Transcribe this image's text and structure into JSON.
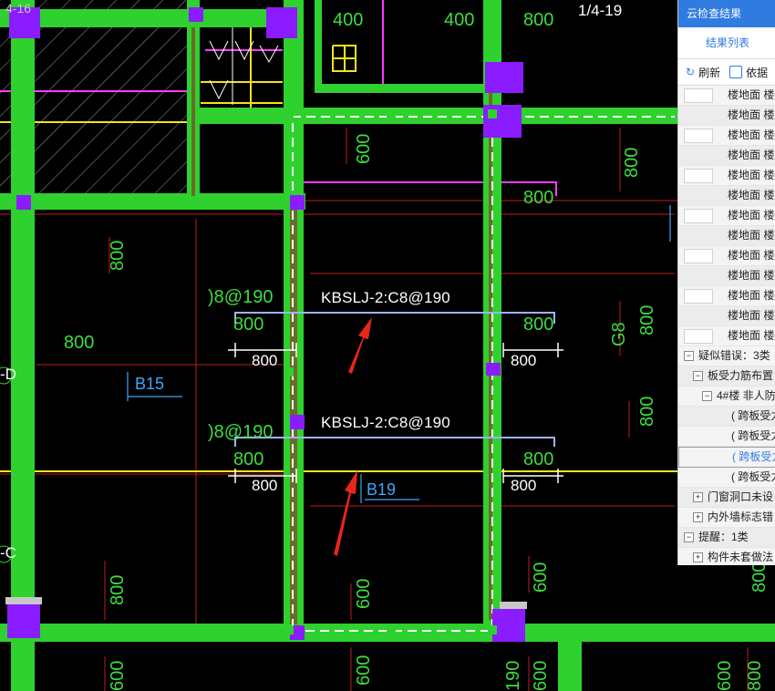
{
  "drawing": {
    "page_label": "1/4-19",
    "top_left_label": "4-16",
    "dims": {
      "d400a": "400",
      "d400b": "400",
      "d800_top": "800",
      "d600_a": "600",
      "d800_b": "800",
      "d800_right1": "800",
      "d800_left": "800",
      "d800_left2": "800",
      "d800_bar1l": "800",
      "d800_bar1r": "800",
      "d800_bar1bl": "800",
      "d800_bar1br": "800",
      "d800_bar2l": "800",
      "d800_bar2r": "800",
      "d800_bar2bl": "800",
      "d800_bar2br": "800",
      "d800_right2": "800",
      "d800_right3": "800",
      "d800_right4": "800",
      "d800_left3": "800",
      "d600_bot1": "600",
      "d600_bot2": "600",
      "d600_bot3": "600",
      "d600_bot4": "600",
      "d600_right5": "600",
      "d190": "190",
      "d600_bot5": "600",
      "d800_br": "800",
      "g8": "G8"
    },
    "notes": {
      "top": "KBSLJ-2:C8@190",
      "bottom": "KBSLJ-2:C8@190",
      "partial1": ")8@190",
      "partial2": ")8@190"
    },
    "slabs": {
      "b15": "B15",
      "b19": "B19"
    },
    "axis": {
      "d": "-D",
      "c": "-C"
    }
  },
  "panel": {
    "title": "云检查结果",
    "tab": "结果列表",
    "refresh": "刷新",
    "basis": "依据",
    "rows": [
      {
        "text": "楼地面 楼",
        "alt": false,
        "cb": true
      },
      {
        "text": "楼地面 楼",
        "alt": true,
        "cb": false
      },
      {
        "text": "楼地面 楼",
        "alt": false,
        "cb": true
      },
      {
        "text": "楼地面 楼",
        "alt": true,
        "cb": false
      },
      {
        "text": "楼地面 楼",
        "alt": false,
        "cb": true
      },
      {
        "text": "楼地面 楼",
        "alt": true,
        "cb": false
      },
      {
        "text": "楼地面 楼",
        "alt": false,
        "cb": true
      },
      {
        "text": "楼地面 楼",
        "alt": true,
        "cb": false
      },
      {
        "text": "楼地面 楼",
        "alt": false,
        "cb": true
      },
      {
        "text": "楼地面 楼",
        "alt": true,
        "cb": false
      },
      {
        "text": "楼地面 楼",
        "alt": false,
        "cb": true
      },
      {
        "text": "楼地面 楼",
        "alt": true,
        "cb": false
      },
      {
        "text": "楼地面 楼",
        "alt": false,
        "cb": true
      }
    ],
    "tree": {
      "suspect": "疑似错误：3类",
      "slab_bar": "板受力筋布置",
      "floor4": "4#楼 非人防",
      "span1": "( 跨板受力",
      "span2": "( 跨板受力",
      "span3": "( 跨板受力",
      "span4": "( 跨板受力",
      "door": "门窗洞口未设",
      "wall": "内外墙标志错",
      "remind": "提醒：1类",
      "comp": "构件未套做法"
    }
  }
}
